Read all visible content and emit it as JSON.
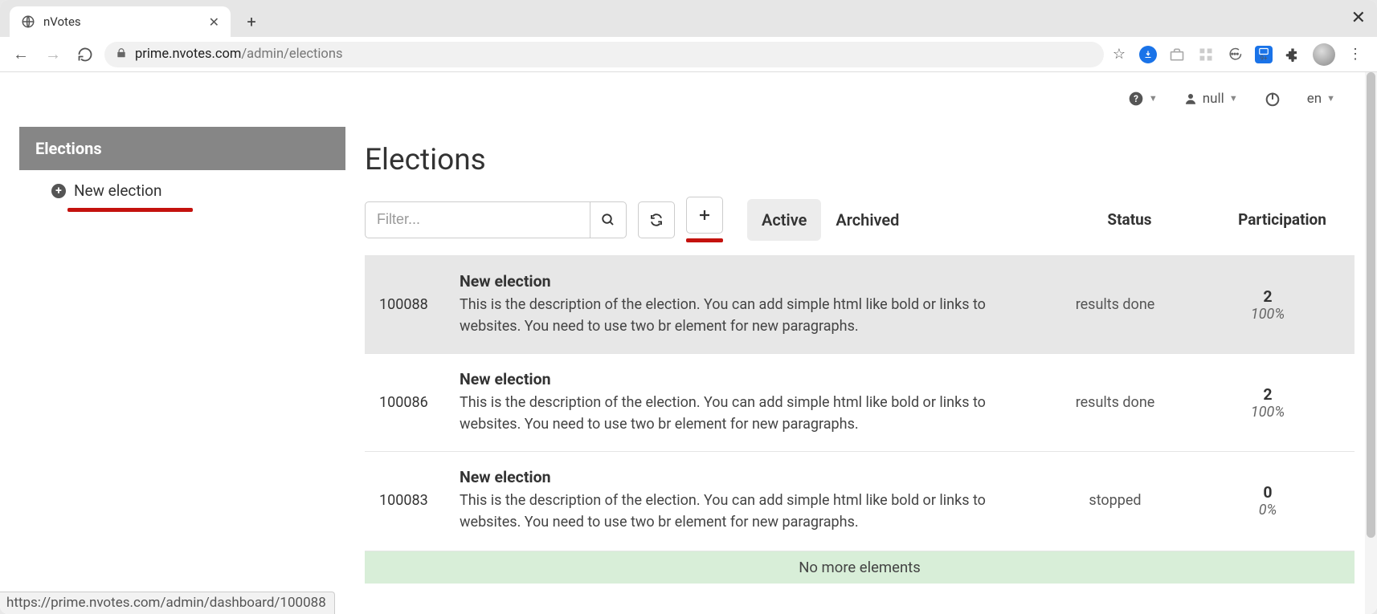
{
  "browser": {
    "tab_title": "nVotes",
    "url_host": "prime.nvotes.com",
    "url_path": "/admin/elections",
    "status_link": "https://prime.nvotes.com/admin/dashboard/100088"
  },
  "topbar": {
    "user_label": "null",
    "lang_label": "en"
  },
  "sidebar": {
    "header": "Elections",
    "new_election": "New election"
  },
  "main": {
    "title": "Elections",
    "filter_placeholder": "Filter...",
    "tabs": {
      "active": "Active",
      "archived": "Archived"
    },
    "columns": {
      "status": "Status",
      "participation": "Participation"
    },
    "rows": [
      {
        "id": "100088",
        "title": "New election",
        "desc": "This is the description of the election. You can add simple html like bold or links to websites. You need to use two br element for new paragraphs.",
        "status": "results done",
        "count": "2",
        "pct": "100%",
        "highlight": true
      },
      {
        "id": "100086",
        "title": "New election",
        "desc": "This is the description of the election. You can add simple html like bold or links to websites. You need to use two br element for new paragraphs.",
        "status": "results done",
        "count": "2",
        "pct": "100%",
        "highlight": false
      },
      {
        "id": "100083",
        "title": "New election",
        "desc": "This is the description of the election. You can add simple html like bold or links to websites. You need to use two br element for new paragraphs.",
        "status": "stopped",
        "count": "0",
        "pct": "0%",
        "highlight": false
      }
    ],
    "no_more": "No more elements"
  }
}
